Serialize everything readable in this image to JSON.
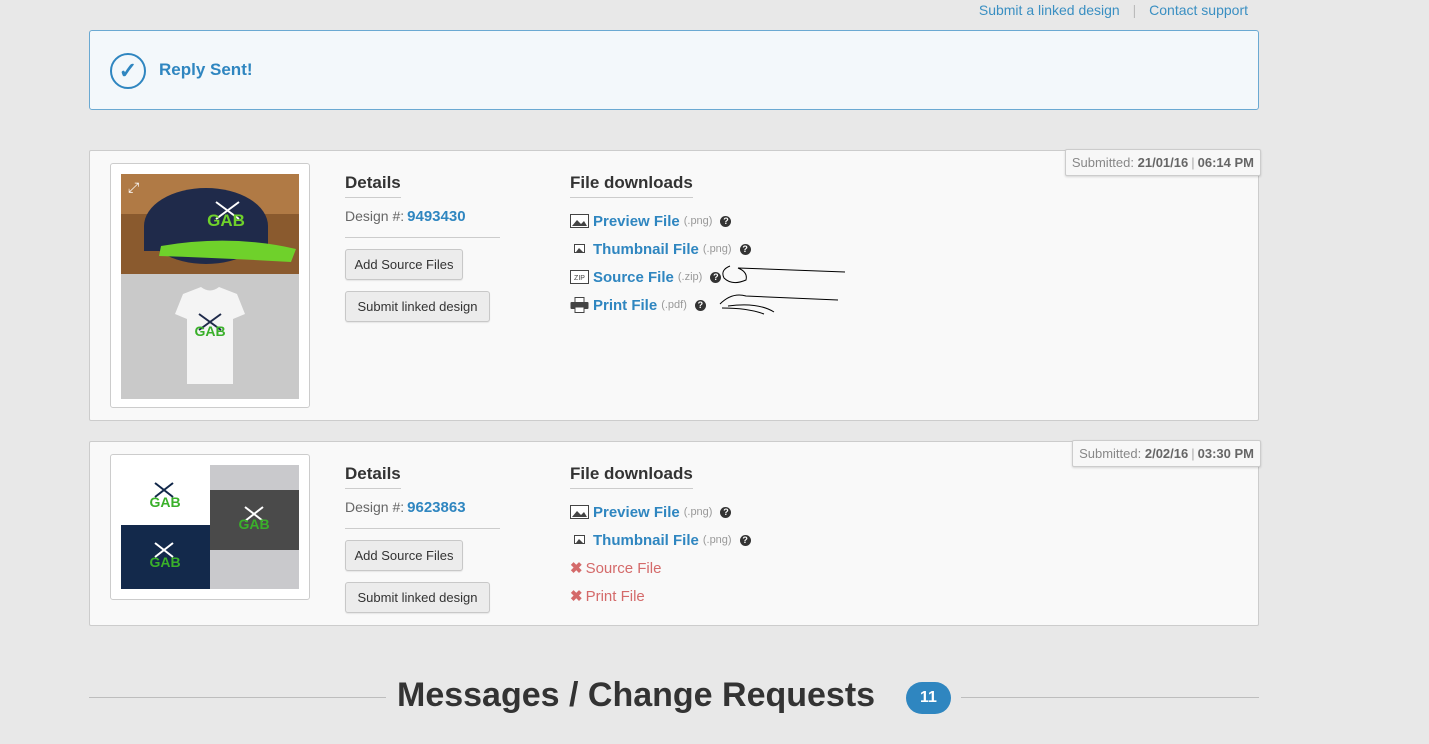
{
  "top_links": {
    "submit_linked": "Submit a linked design",
    "separator": "|",
    "contact_support": "Contact support"
  },
  "alert": {
    "message": "Reply Sent!"
  },
  "designs": [
    {
      "submitted_label": "Submitted:",
      "date": "21/01/16",
      "time": "06:14 PM",
      "details_title": "Details",
      "design_label": "Design #:",
      "design_number": "9493430",
      "add_source_button": "Add Source Files",
      "submit_linked_button": "Submit linked design",
      "files_title": "File downloads",
      "files": [
        {
          "label": "Preview File",
          "ext": "(.png)",
          "icon": "image-icon",
          "available": true
        },
        {
          "label": "Thumbnail File",
          "ext": "(.png)",
          "icon": "small-image-icon",
          "available": true
        },
        {
          "label": "Source File",
          "ext": "(.zip)",
          "icon": "zip-icon",
          "available": true
        },
        {
          "label": "Print File",
          "ext": "(.pdf)",
          "icon": "printer-icon",
          "available": true
        }
      ]
    },
    {
      "submitted_label": "Submitted:",
      "date": "2/02/16",
      "time": "03:30 PM",
      "details_title": "Details",
      "design_label": "Design #:",
      "design_number": "9623863",
      "add_source_button": "Add Source Files",
      "submit_linked_button": "Submit linked design",
      "files_title": "File downloads",
      "files": [
        {
          "label": "Preview File",
          "ext": "(.png)",
          "icon": "image-icon",
          "available": true
        },
        {
          "label": "Thumbnail File",
          "ext": "(.png)",
          "icon": "small-image-icon",
          "available": true
        },
        {
          "label": "Source File",
          "ext": "",
          "icon": "x-icon",
          "available": false
        },
        {
          "label": "Print File",
          "ext": "",
          "icon": "x-icon",
          "available": false
        }
      ]
    }
  ],
  "thumbnail_logo_text": "GAB",
  "messages_section": {
    "title": "Messages / Change Requests",
    "count": "11"
  },
  "colors": {
    "accent": "#2f86c0",
    "missing": "#d46a6a",
    "background": "#e8e8e8",
    "card": "#f9f9f9",
    "cap_green": "#6fd12b",
    "cap_navy": "#1f2a4a"
  }
}
